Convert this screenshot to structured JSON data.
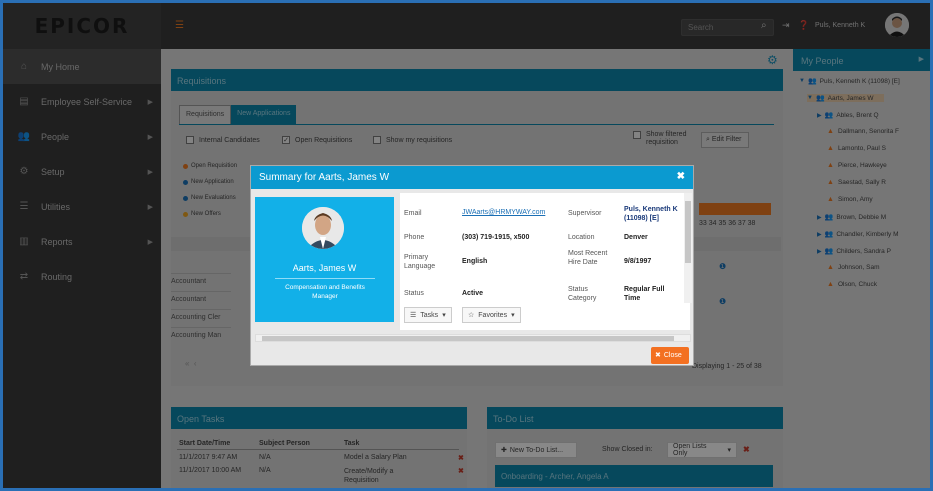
{
  "app": {
    "logo": "EPICOR"
  },
  "sidebar": {
    "items": [
      {
        "label": "My Home",
        "icon": "home-icon"
      },
      {
        "label": "Employee Self-Service",
        "icon": "id-card-icon"
      },
      {
        "label": "People",
        "icon": "people-icon"
      },
      {
        "label": "Setup",
        "icon": "gears-icon"
      },
      {
        "label": "Utilities",
        "icon": "list-icon"
      },
      {
        "label": "Reports",
        "icon": "bar-chart-icon"
      },
      {
        "label": "Routing",
        "icon": "routing-arrows-icon"
      }
    ]
  },
  "topbar": {
    "search_placeholder": "Search",
    "user_name": "Puls, Kenneth K"
  },
  "requisitions": {
    "title": "Requisitions",
    "tabs": [
      "Requisitions",
      "New Applications"
    ],
    "filters": [
      {
        "label": "Internal Candidates",
        "checked": false
      },
      {
        "label": "Open Requisitions",
        "checked": true
      },
      {
        "label": "Show my requisitions",
        "checked": false
      }
    ],
    "show_filtered": "Show filtered requisition",
    "edit_filter": "Edit Filter",
    "legend": [
      {
        "label": "Open Requisition",
        "color": "#e87722"
      },
      {
        "label": "New Application",
        "color": "#1a6fb5"
      },
      {
        "label": "New Evaluations",
        "color": "#1a6fb5"
      },
      {
        "label": "New Offers",
        "color": "#e8a022"
      }
    ],
    "jobs": [
      "Accountant",
      "Accountant",
      "Accounting Cler",
      "Accounting Man"
    ],
    "day_numbers": "33 34 35 36 37 38",
    "displaying": "Displaying 1 - 25 of 38"
  },
  "right_panel": {
    "title": "My People",
    "nodes": [
      {
        "label": "Puls, Kenneth K (11098) [E]",
        "type": "group"
      },
      {
        "label": "Aarts, James W",
        "type": "group",
        "selected": true
      },
      {
        "label": "Ables, Brent Q",
        "type": "group"
      },
      {
        "label": "Dallmann, Senorita F",
        "type": "person"
      },
      {
        "label": "Lamonto, Paul S",
        "type": "person"
      },
      {
        "label": "Pierce, Hawkeye",
        "type": "person"
      },
      {
        "label": "Saestad, Sally R",
        "type": "person"
      },
      {
        "label": "Simon, Amy",
        "type": "person"
      },
      {
        "label": "Brown, Debbie M",
        "type": "group"
      },
      {
        "label": "Chandler, Kimberly M",
        "type": "group"
      },
      {
        "label": "Childers, Sandra P",
        "type": "group"
      },
      {
        "label": "Johnson, Sam",
        "type": "person"
      },
      {
        "label": "Olson, Chuck",
        "type": "person"
      }
    ]
  },
  "open_tasks": {
    "title": "Open Tasks",
    "columns": [
      "Start Date/Time",
      "Subject Person",
      "Task"
    ],
    "rows": [
      [
        "11/1/2017 9:47 AM",
        "N/A",
        "Model a Salary Plan"
      ],
      [
        "11/1/2017 10:00 AM",
        "N/A",
        "Create/Modify a Requisition"
      ]
    ]
  },
  "todo": {
    "title": "To-Do List",
    "new_button": "New To-Do List...",
    "show_closed": "Show Closed in:",
    "select_value": "Open Lists Only",
    "onboarding": "Onboarding - Archer, Angela A"
  },
  "modal": {
    "title": "Summary for Aarts, James W",
    "name": "Aarts, James W",
    "job_title": "Compensation and Benefits Manager",
    "fields": {
      "email_label": "Email",
      "email": "JWAarts@HRMYWAY.com",
      "supervisor_label": "Supervisor",
      "supervisor": "Puls, Kenneth K (11098) [E]",
      "phone_label": "Phone",
      "phone": "(303) 719-1915, x500",
      "location_label": "Location",
      "location": "Denver",
      "language_label": "Primary Language",
      "language": "English",
      "hire_label": "Most Recent Hire Date",
      "hire": "9/8/1997",
      "status_label": "Status",
      "status": "Active",
      "status_cat_label": "Status Category",
      "status_cat": "Regular Full Time"
    },
    "tasks_button": "Tasks",
    "favorites_button": "Favorites",
    "close_button": "Close"
  }
}
